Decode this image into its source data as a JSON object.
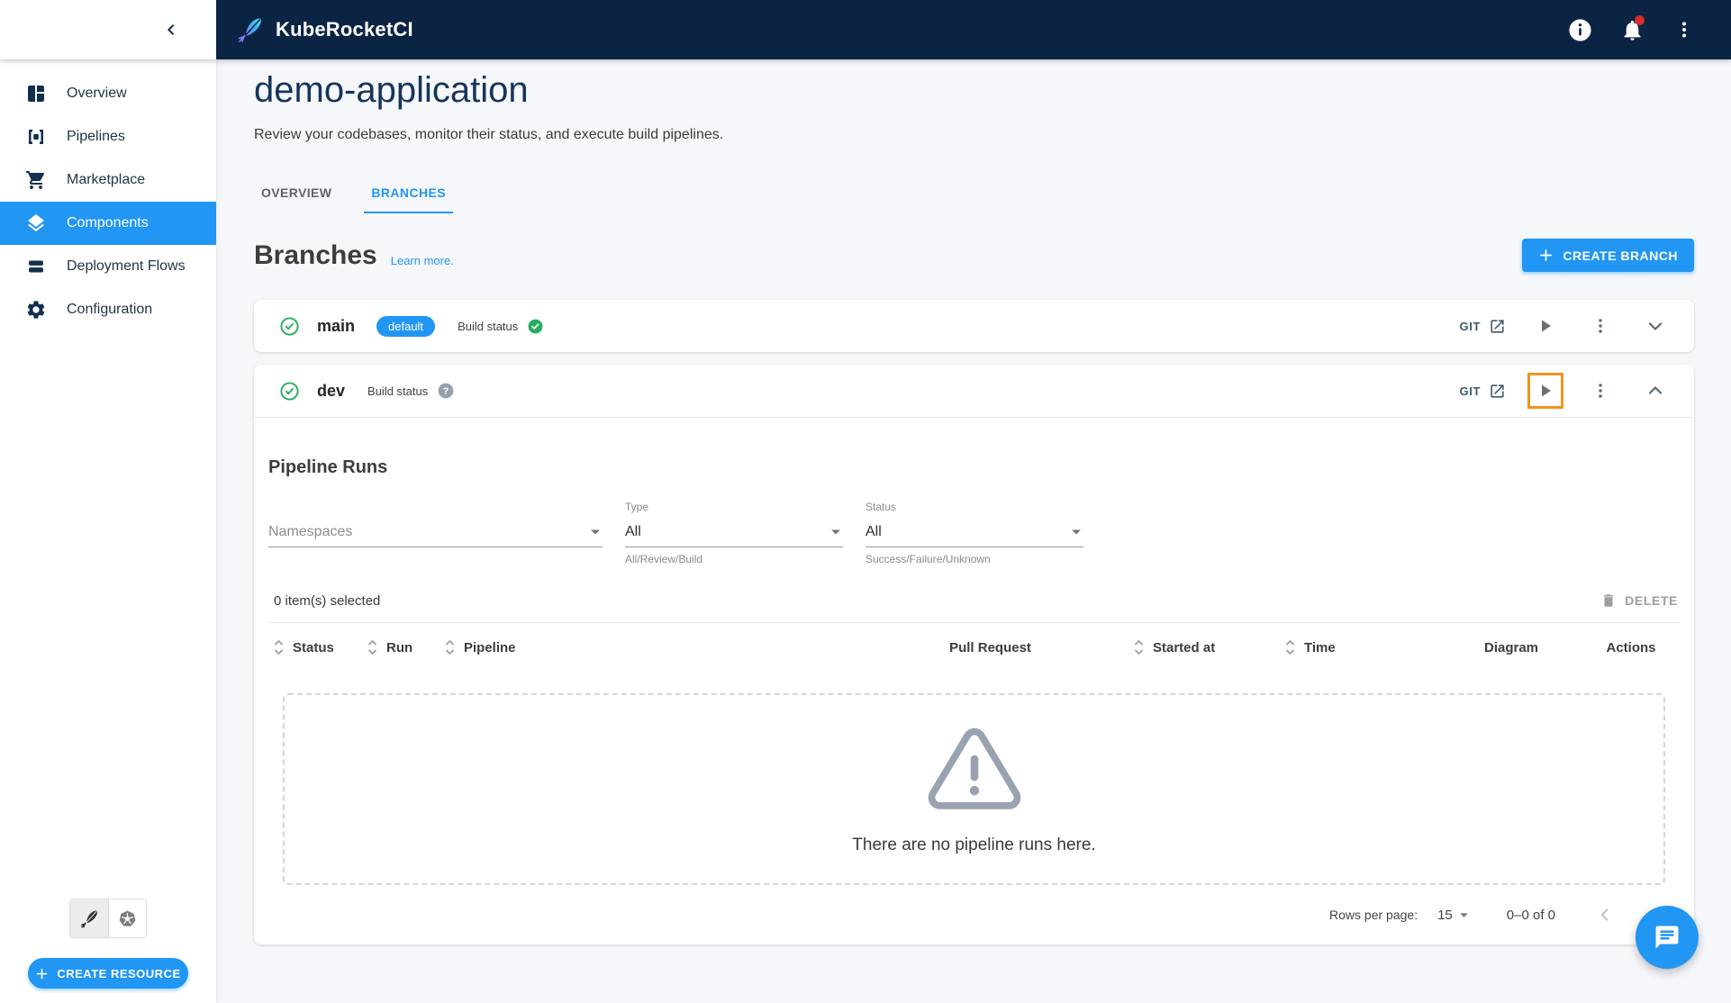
{
  "header": {
    "app_name": "KubeRocketCI",
    "icons": {
      "info": "info-icon",
      "notifications": "bell-icon",
      "menu": "kebab-menu-icon"
    }
  },
  "sidebar": {
    "items": [
      {
        "label": "Overview",
        "icon": "dashboard-icon",
        "selected": false
      },
      {
        "label": "Pipelines",
        "icon": "pipelines-icon",
        "selected": false
      },
      {
        "label": "Marketplace",
        "icon": "cart-icon",
        "selected": false
      },
      {
        "label": "Components",
        "icon": "layers-icon",
        "selected": true
      },
      {
        "label": "Deployment Flows",
        "icon": "stack-icon",
        "selected": false
      },
      {
        "label": "Configuration",
        "icon": "gear-icon",
        "selected": false
      }
    ],
    "create_resource_label": "CREATE RESOURCE"
  },
  "page": {
    "title": "demo-application",
    "subtitle": "Review your codebases, monitor their status, and execute build pipelines.",
    "tabs": [
      {
        "label": "OVERVIEW",
        "active": false
      },
      {
        "label": "BRANCHES",
        "active": true
      }
    ],
    "branches_title": "Branches",
    "learn_more": "Learn more.",
    "create_branch_label": "CREATE BRANCH"
  },
  "branches": [
    {
      "name": "main",
      "badge": "default",
      "build_status_label": "Build status",
      "build_status": "success",
      "git_label": "GIT",
      "expanded": false
    },
    {
      "name": "dev",
      "build_status_label": "Build status",
      "build_status": "unknown",
      "git_label": "GIT",
      "expanded": true
    }
  ],
  "pipeline_runs": {
    "title": "Pipeline Runs",
    "filters": {
      "namespaces_placeholder": "Namespaces",
      "type": {
        "label": "Type",
        "value": "All",
        "helper": "All/Review/Build"
      },
      "status": {
        "label": "Status",
        "value": "All",
        "helper": "Success/Failure/Unknown"
      }
    },
    "selected_text": "0 item(s) selected",
    "delete_label": "DELETE",
    "columns": [
      "Status",
      "Run",
      "Pipeline",
      "Pull Request",
      "Started at",
      "Time",
      "Diagram",
      "Actions"
    ],
    "empty_text": "There are no pipeline runs here.",
    "pagination": {
      "rows_per_page_label": "Rows per page:",
      "rows_per_page_value": "15",
      "range_text": "0–0 of 0"
    }
  },
  "colors": {
    "accent": "#2196f3",
    "topbar": "#0c2444",
    "success": "#27ae60",
    "highlight_orange": "#f0941d",
    "notification_red": "#d62f2f"
  }
}
